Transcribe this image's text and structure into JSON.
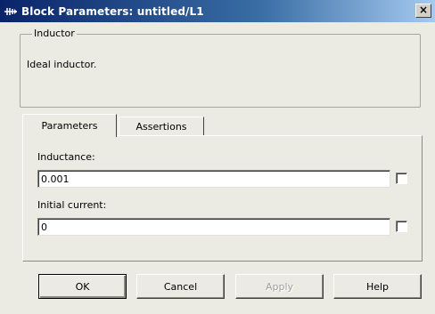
{
  "window": {
    "title": "Block Parameters: untitled/L1",
    "close_label": "×"
  },
  "group": {
    "legend": "Inductor",
    "description": "Ideal inductor."
  },
  "tabs": [
    {
      "label": "Parameters",
      "active": true
    },
    {
      "label": "Assertions",
      "active": false
    }
  ],
  "fields": {
    "inductance": {
      "label": "Inductance:",
      "value": "0.001",
      "checked": false
    },
    "initial_current": {
      "label": "Initial current:",
      "value": "0",
      "checked": false
    }
  },
  "buttons": {
    "ok": "OK",
    "cancel": "Cancel",
    "apply": "Apply",
    "help": "Help"
  },
  "colors": {
    "titlebar_start": "#0a246a",
    "titlebar_end": "#a6caf0",
    "dialog_bg": "#ebeae3"
  },
  "icons": {
    "title": "block-diagram-icon"
  }
}
